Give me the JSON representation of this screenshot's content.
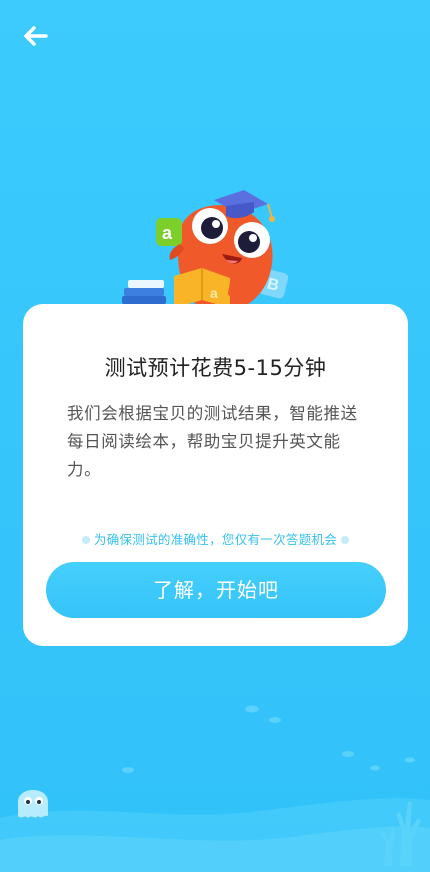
{
  "nav": {
    "back_icon": "arrow-left-icon"
  },
  "card": {
    "title": "测试预计花费5-15分钟",
    "description": "我们会根据宝贝的测试结果，智能推送每日阅读绘本，帮助宝贝提升英文能力。",
    "notice": "为确保测试的准确性，您仅有一次答题机会",
    "cta_label": "了解，开始吧"
  },
  "colors": {
    "background": "#35c5fb",
    "accent": "#39c2ef",
    "button": "#3dc9fb",
    "mascot": "#f05a2a"
  }
}
